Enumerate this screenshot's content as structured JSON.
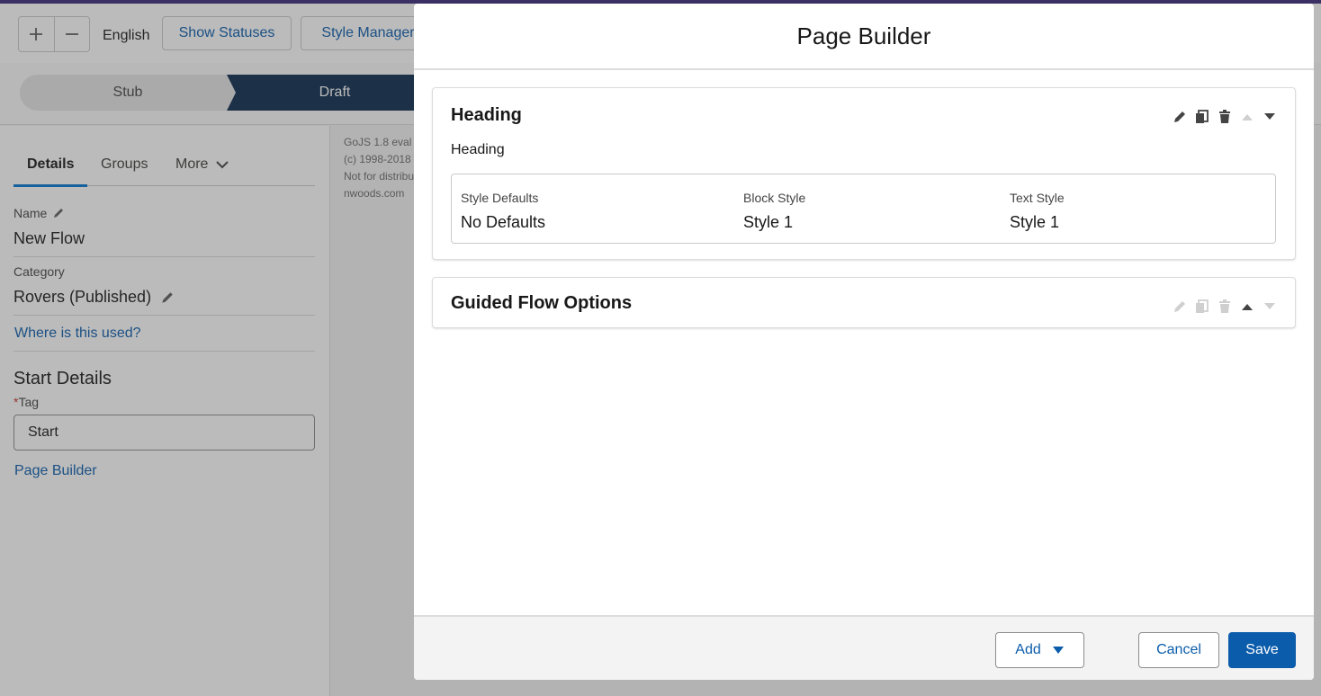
{
  "toolbar": {
    "zoom_in_icon": "plus-icon",
    "zoom_out_icon": "minus-icon",
    "language": "English",
    "show_statuses": "Show Statuses",
    "style_manager": "Style Manager"
  },
  "path": {
    "stages": [
      "Stub",
      "Draft"
    ],
    "active_stage": "Draft"
  },
  "left_panel": {
    "tabs": [
      "Details",
      "Groups",
      "More"
    ],
    "active_tab": "Details",
    "name_label": "Name",
    "name_value": "New Flow",
    "category_label": "Category",
    "category_value": "Rovers (Published)",
    "where_used_link": "Where is this used?",
    "start_details_title": "Start Details",
    "tag_required_marker": "*",
    "tag_label": "Tag",
    "tag_value": "Start",
    "page_builder_link": "Page Builder"
  },
  "canvas": {
    "lines": [
      "GoJS 1.8 eval",
      "(c) 1998-2018",
      "Not for distribu",
      "nwoods.com"
    ]
  },
  "modal": {
    "title": "Page Builder",
    "cards": [
      {
        "title": "Heading",
        "subtitle": "Heading",
        "style_defaults_label": "Style Defaults",
        "style_defaults_value": "No Defaults",
        "block_style_label": "Block Style",
        "block_style_value": "Style 1",
        "text_style_label": "Text Style",
        "text_style_value": "Style 1"
      },
      {
        "title": "Guided Flow Options"
      }
    ],
    "footer": {
      "add_label": "Add",
      "cancel_label": "Cancel",
      "save_label": "Save"
    }
  },
  "colors": {
    "brand": "#0b5cab",
    "path_active": "#0b2a4e",
    "top_strip": "#3b2a7a"
  }
}
